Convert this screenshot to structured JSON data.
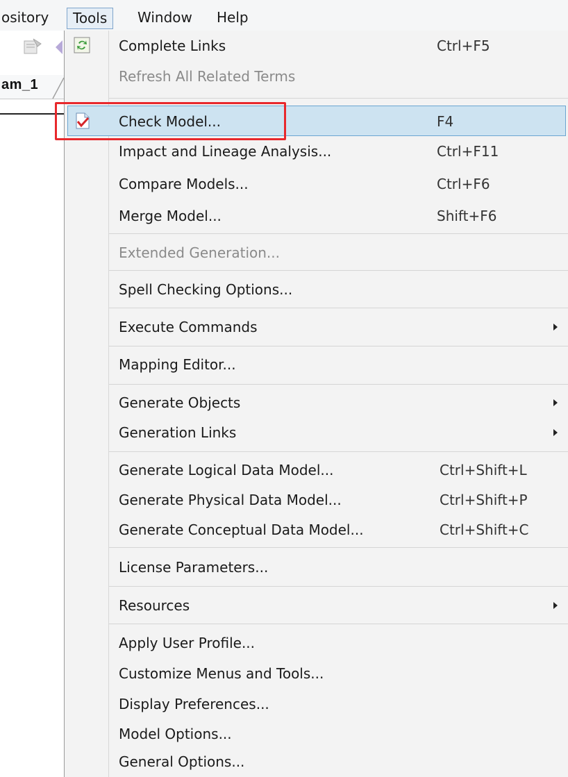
{
  "menubar": {
    "items": [
      {
        "label": "ository"
      },
      {
        "label": "Tools"
      },
      {
        "label": "Window"
      },
      {
        "label": "Help"
      }
    ]
  },
  "background": {
    "tab_label": "am_1"
  },
  "dropdown": {
    "items": [
      {
        "label": "Complete Links",
        "shortcut": "Ctrl+F5",
        "icon": "complete-links-icon"
      },
      {
        "label": "Refresh All Related Terms",
        "shortcut": "",
        "disabled": true
      },
      {
        "label": "Check Model...",
        "shortcut": "F4",
        "icon": "check-model-icon",
        "highlighted": true
      },
      {
        "label": "Impact and Lineage Analysis...",
        "shortcut": "Ctrl+F11"
      },
      {
        "label": "Compare Models...",
        "shortcut": "Ctrl+F6"
      },
      {
        "label": "Merge Model...",
        "shortcut": "Shift+F6"
      },
      {
        "label": "Extended Generation...",
        "shortcut": "",
        "disabled": true
      },
      {
        "label": "Spell Checking Options...",
        "shortcut": ""
      },
      {
        "label": "Execute Commands",
        "shortcut": "",
        "submenu": true
      },
      {
        "label": "Mapping Editor...",
        "shortcut": ""
      },
      {
        "label": "Generate Objects",
        "shortcut": "",
        "submenu": true
      },
      {
        "label": "Generation Links",
        "shortcut": "",
        "submenu": true
      },
      {
        "label": "Generate Logical Data Model...",
        "shortcut": "Ctrl+Shift+L"
      },
      {
        "label": "Generate Physical Data Model...",
        "shortcut": "Ctrl+Shift+P"
      },
      {
        "label": "Generate Conceptual Data Model...",
        "shortcut": "Ctrl+Shift+C"
      },
      {
        "label": "License Parameters...",
        "shortcut": ""
      },
      {
        "label": "Resources",
        "shortcut": "",
        "submenu": true
      },
      {
        "label": "Apply User Profile...",
        "shortcut": ""
      },
      {
        "label": "Customize Menus and Tools...",
        "shortcut": ""
      },
      {
        "label": "Display Preferences...",
        "shortcut": ""
      },
      {
        "label": "Model Options...",
        "shortcut": ""
      },
      {
        "label": "General Options...",
        "shortcut": ""
      }
    ]
  },
  "colors": {
    "hover_bg": "#cde3f1",
    "hover_border": "#6aa5d1",
    "annotation_red": "#e8282c"
  }
}
